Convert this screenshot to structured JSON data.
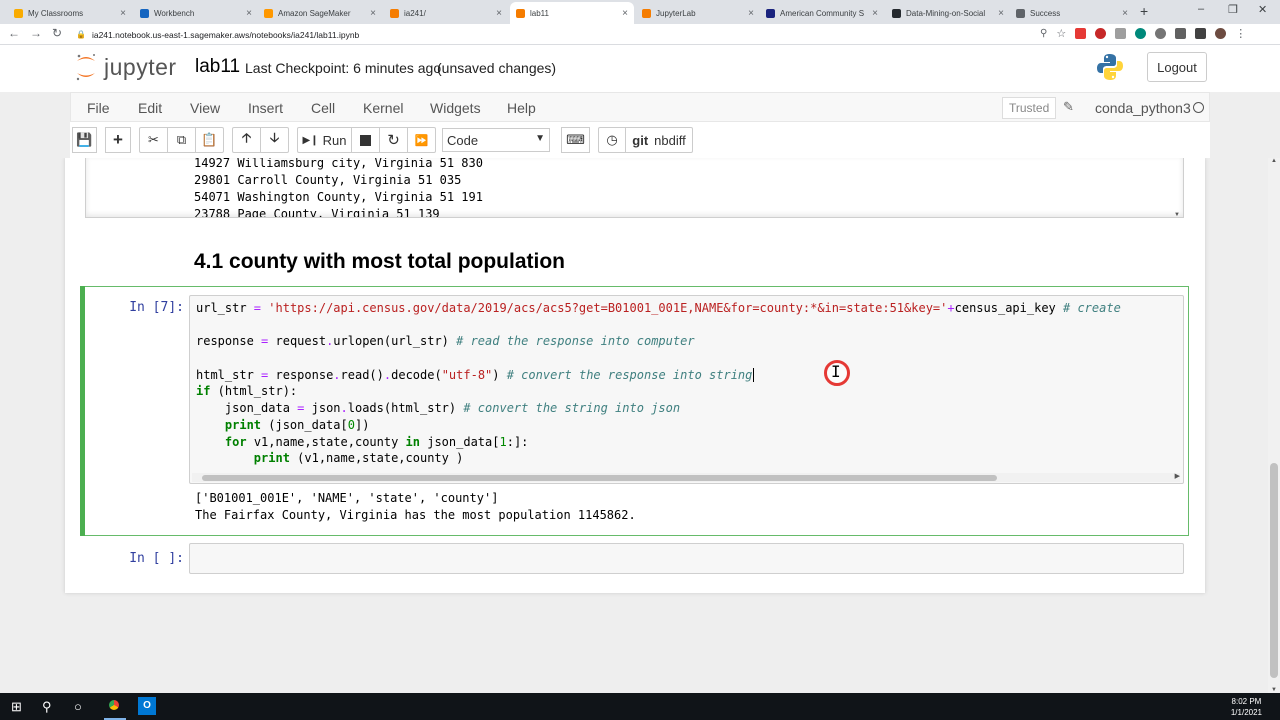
{
  "browser": {
    "tabs": [
      {
        "label": "My Classrooms",
        "color": "#f9ab00",
        "active": false
      },
      {
        "label": "Workbench",
        "color": "#1565c0",
        "active": false
      },
      {
        "label": "Amazon SageMaker",
        "color": "#ff9800",
        "active": false
      },
      {
        "label": "ia241/",
        "color": "#f57c00",
        "active": false
      },
      {
        "label": "lab11",
        "color": "#f57c00",
        "active": true
      },
      {
        "label": "JupyterLab",
        "color": "#f57c00",
        "active": false
      },
      {
        "label": "American Community S",
        "color": "#1a237e",
        "active": false
      },
      {
        "label": "Data-Mining-on-Social",
        "color": "#24292e",
        "active": false
      },
      {
        "label": "Success",
        "color": "#5f6368",
        "active": false
      }
    ],
    "new_tab": "+",
    "url": "ia241.notebook.us-east-1.sagemaker.aws/notebooks/ia241/lab11.ipynb"
  },
  "jupyter": {
    "logo_text": "jupyter",
    "notebook_name": "lab11",
    "checkpoint": "Last Checkpoint: 6 minutes ago",
    "save_status": "(unsaved changes)",
    "logout": "Logout",
    "menu": [
      "File",
      "Edit",
      "View",
      "Insert",
      "Cell",
      "Kernel",
      "Widgets",
      "Help"
    ],
    "trusted": "Trusted",
    "kernel": "conda_python3",
    "toolbar": {
      "run": "Run",
      "cell_type": "Code",
      "git": "git",
      "nbdiff": "nbdiff"
    }
  },
  "notebook": {
    "previous_output": [
      "14927 Williamsburg city, Virginia 51 830",
      "29801 Carroll County, Virginia 51 035",
      "54071 Washington County, Virginia 51 191",
      "23788 Page County, Virginia 51 139"
    ],
    "heading": "4.1 county with most total population",
    "cell1": {
      "prompt": "In [7]:",
      "output": [
        "['B01001_001E', 'NAME', 'state', 'county']",
        "The Fairfax County, Virginia has the most population 1145862."
      ]
    },
    "cell2": {
      "prompt": "In [ ]:"
    }
  },
  "taskbar": {
    "time": "8:02 PM",
    "date": "1/1/2021"
  }
}
